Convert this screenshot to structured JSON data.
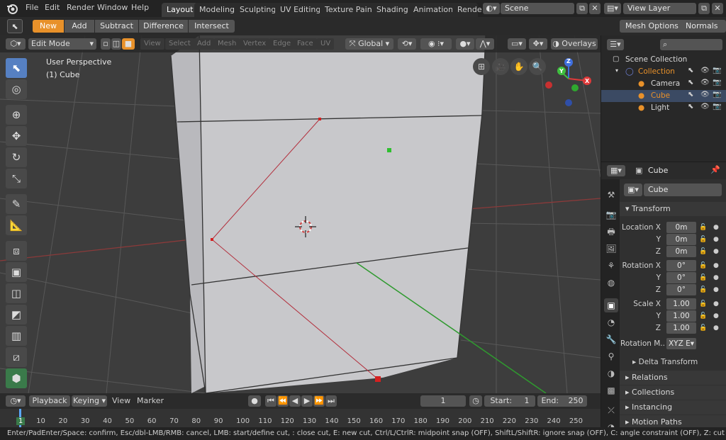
{
  "menu": [
    "File",
    "Edit",
    "Render",
    "Window",
    "Help"
  ],
  "workspaces": [
    "Layout",
    "Modeling",
    "Sculpting",
    "UV Editing",
    "Texture Paint",
    "Shading",
    "Animation",
    "Rende"
  ],
  "scene": "Scene",
  "view_layer": "View Layer",
  "tool_header": {
    "modes": [
      "New",
      "Add",
      "Subtract",
      "Difference",
      "Intersect"
    ],
    "mesh_options": "Mesh Options",
    "normals": "Normals"
  },
  "viewport": {
    "mode": "Edit Mode",
    "menus": [
      "View",
      "Select",
      "Add",
      "Mesh",
      "Vertex",
      "Edge",
      "Face",
      "UV"
    ],
    "orientation": "Global",
    "overlays": "Overlays",
    "info_line1": "User Perspective",
    "info_line2": "(1) Cube"
  },
  "gizmo": {
    "x": "X",
    "y": "Y",
    "z": "Z"
  },
  "outliner": {
    "root": "Scene Collection",
    "collection": "Collection",
    "items": [
      "Camera",
      "Cube",
      "Light"
    ]
  },
  "properties": {
    "object_name": "Cube",
    "data_name": "Cube",
    "transform_title": "Transform",
    "location": {
      "label": "Location X",
      "x": "0m",
      "y": "0m",
      "z": "0m"
    },
    "rotation": {
      "label": "Rotation X",
      "x": "0°",
      "y": "0°",
      "z": "0°"
    },
    "scale": {
      "label": "Scale X",
      "x": "1.00",
      "y": "1.00",
      "z": "1.00"
    },
    "axis_y": "Y",
    "axis_z": "Z",
    "rotation_mode_label": "Rotation M..",
    "rotation_mode": "XYZ E",
    "delta_transform": "Delta Transform",
    "panels": [
      "Relations",
      "Collections",
      "Instancing",
      "Motion Paths"
    ]
  },
  "timeline": {
    "playback": "Playback",
    "keying": "Keying",
    "view": "View",
    "marker": "Marker",
    "current_frame": "1",
    "start_label": "Start:",
    "start": "1",
    "end_label": "End:",
    "end": "250",
    "ticks": [
      "1",
      "10",
      "20",
      "30",
      "40",
      "50",
      "60",
      "70",
      "80",
      "90",
      "100",
      "110",
      "120",
      "130",
      "140",
      "150",
      "160",
      "170",
      "180",
      "190",
      "200",
      "210",
      "220",
      "230",
      "240",
      "250"
    ]
  },
  "status_bar": "Enter/PadEnter/Space: confirm, Esc/dbl-LMB/RMB: cancel, LMB: start/define cut, : close cut, E: new cut, Ctrl/L/CtrlR: midpoint snap (OFF), ShiftL/ShiftR: ignore snap (OFF), C: angle constraint (OFF), Z: cut through (OFF), MMB: panning",
  "colors": {
    "accent": "#e8912a",
    "selection": "#5680c2",
    "knife_cut": "#b3313e",
    "x_axis": "#e03a3a",
    "y_axis": "#3fbf3f",
    "z_axis": "#3f6fdf"
  }
}
